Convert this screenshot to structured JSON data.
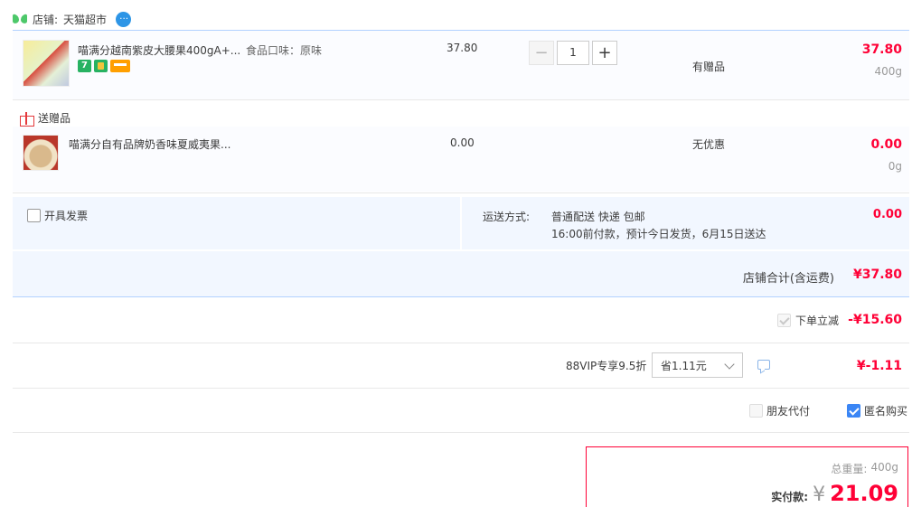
{
  "shop": {
    "label": "店铺:",
    "name": "天猫超市"
  },
  "items": [
    {
      "title": "喵满分越南紫皮大腰果400gA+...",
      "attr": "食品口味：原味",
      "unit_price": "37.80",
      "quantity": "1",
      "promo": "有赠品",
      "subtotal": "37.80",
      "weight": "400g",
      "tag_seven": "7"
    }
  ],
  "gift_section": {
    "label": "送赠品",
    "item": {
      "title": "喵满分自有品牌奶香味夏威夷果...",
      "unit_price": "0.00",
      "promo": "无优惠",
      "subtotal": "0.00",
      "weight": "0g"
    }
  },
  "invoice": {
    "label": "开具发票"
  },
  "shipping": {
    "label": "运送方式:",
    "method": "普通配送 快递 包邮",
    "note": "16:00前付款，预计今日发货，6月15日送达",
    "fee": "0.00"
  },
  "shop_total": {
    "label": "店铺合计(含运费)",
    "value": "¥37.80"
  },
  "discount": {
    "label": "下单立减",
    "value": "-¥15.60"
  },
  "vip": {
    "label": "88VIP专享9.5折",
    "select_value": "省1.11元",
    "value": "¥-1.11"
  },
  "options": {
    "friend_pay": "朋友代付",
    "anonymous": "匿名购买"
  },
  "summary": {
    "weight_label": "总重量:",
    "weight": "400g",
    "pay_label": "实付款:",
    "currency": "¥",
    "amount": "21.09"
  },
  "colors": {
    "accent": "#ff0036",
    "line": "#b2d1ff",
    "checkbox": "#3b86f5"
  }
}
